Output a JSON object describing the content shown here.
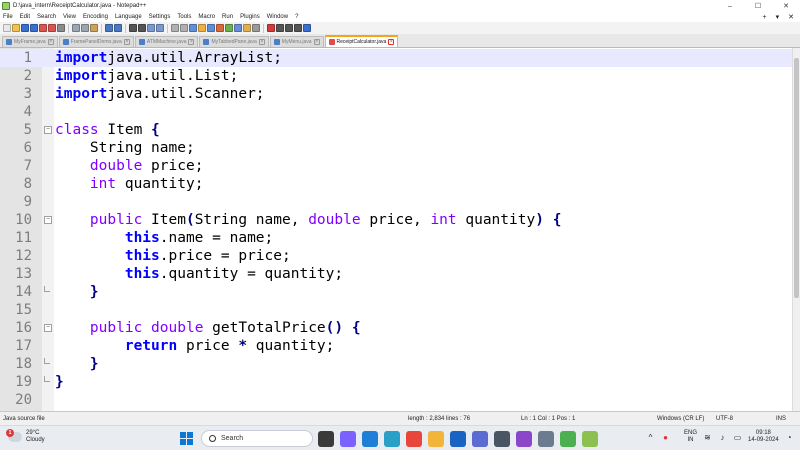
{
  "window": {
    "title": "D:\\java_intern\\ReceiptCalculator.java - Notepad++",
    "controls": {
      "minimize": "–",
      "maximize": "☐",
      "close": "✕"
    }
  },
  "menu": {
    "items": [
      "File",
      "Edit",
      "Search",
      "View",
      "Encoding",
      "Language",
      "Settings",
      "Tools",
      "Macro",
      "Run",
      "Plugins",
      "Window",
      "?"
    ],
    "right": {
      "plus": "+",
      "dropdown": "▾",
      "close": "✕"
    }
  },
  "toolbar": {
    "buttons": [
      {
        "icon": "new-file-icon",
        "color": "#e8e8e8"
      },
      {
        "icon": "open-file-icon",
        "color": "#f2c14e"
      },
      {
        "icon": "save-icon",
        "color": "#3b6fcc"
      },
      {
        "icon": "save-all-icon",
        "color": "#3b6fcc"
      },
      {
        "icon": "close-icon",
        "color": "#d9534f"
      },
      {
        "icon": "close-all-icon",
        "color": "#d9534f"
      },
      {
        "icon": "print-icon",
        "color": "#8a8a8a"
      },
      {
        "icon": "cut-icon",
        "color": "#9aa6b2"
      },
      {
        "icon": "copy-icon",
        "color": "#9aa6b2"
      },
      {
        "icon": "paste-icon",
        "color": "#c9a35a"
      },
      {
        "icon": "undo-icon",
        "color": "#4a78c2"
      },
      {
        "icon": "redo-icon",
        "color": "#4a78c2"
      },
      {
        "icon": "find-icon",
        "color": "#555555"
      },
      {
        "icon": "replace-icon",
        "color": "#555555"
      },
      {
        "icon": "zoom-in-icon",
        "color": "#7a9acf"
      },
      {
        "icon": "zoom-out-icon",
        "color": "#7a9acf"
      },
      {
        "icon": "sync-vertical-icon",
        "color": "#b0b0b0"
      },
      {
        "icon": "sync-horizontal-icon",
        "color": "#b0b0b0"
      },
      {
        "icon": "word-wrap-icon",
        "color": "#5f8fd8"
      },
      {
        "icon": "show-all-chars-icon",
        "color": "#f0b040"
      },
      {
        "icon": "indent-guide-icon",
        "color": "#5f8fd8"
      },
      {
        "icon": "udl-icon",
        "color": "#d96a3a"
      },
      {
        "icon": "doc-map-icon",
        "color": "#6ab04c"
      },
      {
        "icon": "function-list-icon",
        "color": "#6a8cd8"
      },
      {
        "icon": "folder-workspace-icon",
        "color": "#e0b050"
      },
      {
        "icon": "monitoring-icon",
        "color": "#9a9a9a"
      },
      {
        "icon": "record-macro-icon",
        "color": "#d33a3a"
      },
      {
        "icon": "stop-macro-icon",
        "color": "#555555"
      },
      {
        "icon": "play-macro-icon",
        "color": "#555555"
      },
      {
        "icon": "run-macro-icon",
        "color": "#555555"
      },
      {
        "icon": "save-macro-icon",
        "color": "#3b6fcc"
      }
    ]
  },
  "tabs": [
    {
      "label": "MyFrame.java",
      "active": false
    },
    {
      "label": "FramePanelDemo.java",
      "active": false
    },
    {
      "label": "ATMMachine.java",
      "active": false
    },
    {
      "label": "MyTabbedPane.java",
      "active": false
    },
    {
      "label": "MyMenu.java",
      "active": false
    },
    {
      "label": "ReceiptCalculator.java",
      "active": true
    }
  ],
  "editor": {
    "lines": [
      {
        "num": "1",
        "fold": "",
        "tokens": [
          [
            "kw",
            "import"
          ],
          [
            "",
            "java.util.ArrayList;"
          ]
        ]
      },
      {
        "num": "2",
        "fold": "",
        "tokens": [
          [
            "kw",
            "import"
          ],
          [
            "",
            "java.util.List;"
          ]
        ]
      },
      {
        "num": "3",
        "fold": "",
        "tokens": [
          [
            "kw",
            "import"
          ],
          [
            "",
            "java.util.Scanner;"
          ]
        ]
      },
      {
        "num": "4",
        "fold": "",
        "tokens": []
      },
      {
        "num": "5",
        "fold": "⊟",
        "tokens": [
          [
            "kw2",
            "class"
          ],
          [
            "",
            " Item "
          ],
          [
            "op",
            "{"
          ]
        ]
      },
      {
        "num": "6",
        "fold": "",
        "tokens": [
          [
            "",
            "    String name;"
          ]
        ]
      },
      {
        "num": "7",
        "fold": "",
        "tokens": [
          [
            "",
            "    "
          ],
          [
            "kw2",
            "double"
          ],
          [
            "",
            " price;"
          ]
        ]
      },
      {
        "num": "8",
        "fold": "",
        "tokens": [
          [
            "",
            "    "
          ],
          [
            "kw2",
            "int"
          ],
          [
            "",
            " quantity;"
          ]
        ]
      },
      {
        "num": "9",
        "fold": "",
        "tokens": []
      },
      {
        "num": "10",
        "fold": "⊟",
        "tokens": [
          [
            "",
            "    "
          ],
          [
            "kw2",
            "public"
          ],
          [
            "",
            " Item"
          ],
          [
            "op",
            "("
          ],
          [
            "",
            "String name, "
          ],
          [
            "kw2",
            "double"
          ],
          [
            "",
            " price, "
          ],
          [
            "kw2",
            "int"
          ],
          [
            "",
            " quantity"
          ],
          [
            "op",
            ")"
          ],
          [
            "",
            " "
          ],
          [
            "op",
            "{"
          ]
        ]
      },
      {
        "num": "11",
        "fold": "",
        "tokens": [
          [
            "",
            "        "
          ],
          [
            "kw",
            "this"
          ],
          [
            "",
            ".name = name;"
          ]
        ]
      },
      {
        "num": "12",
        "fold": "",
        "tokens": [
          [
            "",
            "        "
          ],
          [
            "kw",
            "this"
          ],
          [
            "",
            ".price = price;"
          ]
        ]
      },
      {
        "num": "13",
        "fold": "",
        "tokens": [
          [
            "",
            "        "
          ],
          [
            "kw",
            "this"
          ],
          [
            "",
            ".quantity = quantity;"
          ]
        ]
      },
      {
        "num": "14",
        "fold": "end",
        "tokens": [
          [
            "",
            "    "
          ],
          [
            "op",
            "}"
          ]
        ]
      },
      {
        "num": "15",
        "fold": "",
        "tokens": []
      },
      {
        "num": "16",
        "fold": "⊟",
        "tokens": [
          [
            "",
            "    "
          ],
          [
            "kw2",
            "public"
          ],
          [
            "",
            " "
          ],
          [
            "kw2",
            "double"
          ],
          [
            "",
            " getTotalPrice"
          ],
          [
            "op",
            "()"
          ],
          [
            "",
            " "
          ],
          [
            "op",
            "{"
          ]
        ]
      },
      {
        "num": "17",
        "fold": "",
        "tokens": [
          [
            "",
            "        "
          ],
          [
            "kw",
            "return"
          ],
          [
            "",
            " price "
          ],
          [
            "op",
            "*"
          ],
          [
            "",
            " quantity;"
          ]
        ]
      },
      {
        "num": "18",
        "fold": "end",
        "tokens": [
          [
            "",
            "    "
          ],
          [
            "op",
            "}"
          ]
        ]
      },
      {
        "num": "19",
        "fold": "end",
        "tokens": [
          [
            "op",
            "}"
          ]
        ]
      },
      {
        "num": "20",
        "fold": "",
        "tokens": []
      }
    ]
  },
  "status": {
    "file_type": "Java source file",
    "length": "length : 2,834    lines : 76",
    "position": "Ln : 1    Col : 1    Pos : 1",
    "eol": "Windows (CR LF)",
    "encoding": "UTF-8",
    "mode": "INS"
  },
  "taskbar": {
    "weather": {
      "temp": "29°C",
      "condition": "Cloudy",
      "badge": "1"
    },
    "search_placeholder": "Search",
    "apps": [
      {
        "icon": "task-view-icon",
        "color": "#3a3a3a"
      },
      {
        "icon": "copilot-icon",
        "color": "#7b61ff"
      },
      {
        "icon": "vscode-icon",
        "color": "#1f7fd6"
      },
      {
        "icon": "edge-icon",
        "color": "#2aa0c8"
      },
      {
        "icon": "chrome-icon",
        "color": "#e8453c"
      },
      {
        "icon": "file-explorer-icon",
        "color": "#f2b53a"
      },
      {
        "icon": "outlook-icon",
        "color": "#1a63c2"
      },
      {
        "icon": "store-icon",
        "color": "#5c6bd1"
      },
      {
        "icon": "terminal-icon",
        "color": "#4a5563"
      },
      {
        "icon": "visual-studio-icon",
        "color": "#8b46c9"
      },
      {
        "icon": "snipping-icon",
        "color": "#6b7c8f"
      },
      {
        "icon": "chrome-profile-icon",
        "color": "#4caf50"
      },
      {
        "icon": "notepadpp-icon",
        "color": "#8cc152"
      }
    ],
    "tray": {
      "chevron": "^",
      "lang": "ENG",
      "region": "IN",
      "time": "09:18",
      "date": "14-09-2024"
    }
  }
}
